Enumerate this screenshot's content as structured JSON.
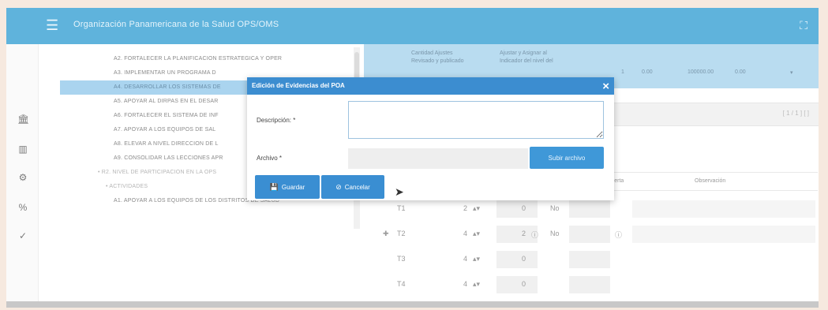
{
  "header": {
    "title": "Organización Panamericana de la Salud OPS/OMS",
    "menu_icon": "hamburger-menu-icon",
    "expand_icon": "fullscreen-icon"
  },
  "sidebar_icons": [
    "bank-icon",
    "bar-chart-icon",
    "gear-icon",
    "percent-icon",
    "check-icon"
  ],
  "tree": {
    "items": [
      {
        "label": "A2. FORTALECER LA PLANIFICACION ESTRATEGICA Y OPER",
        "selected": false
      },
      {
        "label": "A3. IMPLEMENTAR UN PROGRAMA D",
        "selected": false
      },
      {
        "label": "A4. DESARROLLAR LOS SISTEMAS DE",
        "selected": true
      },
      {
        "label": "A5. APOYAR AL DIRPAS EN EL DESAR",
        "selected": false
      },
      {
        "label": "A6. FORTALECER EL SISTEMA DE INF",
        "selected": false
      },
      {
        "label": "A7. APOYAR A LOS EQUIPOS DE SAL",
        "selected": false
      },
      {
        "label": "A8. ELEVAR A NIVEL DIRECCION DE L",
        "selected": false
      },
      {
        "label": "A9. CONSOLIDAR LAS LECCIONES APR",
        "selected": false
      }
    ],
    "sub1": "• R2. NIVEL DE PARTICIPACION EN LA OPS",
    "sub2": "• ACTIVIDADES",
    "leaf": "A1. APOYAR A LOS EQUIPOS DE LOS DISTRITOS DE SALUD"
  },
  "grid_header": {
    "col1": "Cantidad Ajustes",
    "col1b": "Revisado y publicado",
    "col2": "Ajustar y Asignar al",
    "col2b": "Indicador del nivel del",
    "v1": "1",
    "v2": "0.00",
    "v3": "100000.00",
    "v4": "0.00"
  },
  "pager": "[ 1 / 1 ] [ ]",
  "columns": {
    "alerta": "Alerta",
    "observacion": "Observación"
  },
  "rows": [
    {
      "t": "T1",
      "n": "2",
      "v": "0",
      "s": "No"
    },
    {
      "t": "T2",
      "n": "4",
      "v": "2",
      "s": "No"
    },
    {
      "t": "T3",
      "n": "4",
      "v": "0",
      "s": ""
    },
    {
      "t": "T4",
      "n": "4",
      "v": "0",
      "s": ""
    }
  ],
  "modal": {
    "title": "Edición de Evidencias del POA",
    "close": "×",
    "description_label": "Descripción: *",
    "description_value": "",
    "file_label": "Archivo *",
    "file_value": "",
    "browse_label": "Subir archivo",
    "save_label": "Guardar",
    "cancel_label": "Cancelar",
    "save_icon": "floppy-icon",
    "cancel_icon": "ban-icon"
  }
}
